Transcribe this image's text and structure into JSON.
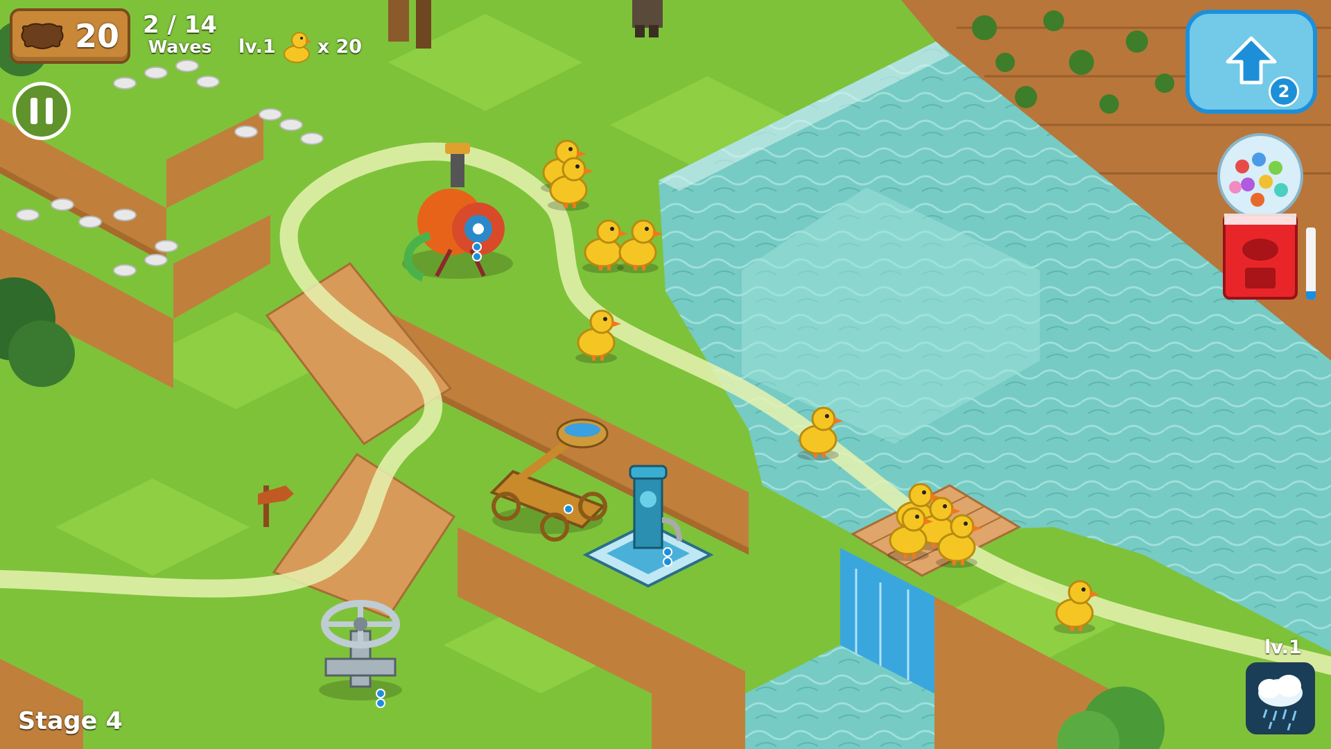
{
  "hud": {
    "currency": {
      "icon": "leather-hide-icon",
      "value": "20",
      "color": "#c98838"
    },
    "waves": {
      "count": "2 / 14",
      "label": "Waves"
    },
    "enemy_info": {
      "level": "lv.1",
      "icon": "yellow-duck-icon",
      "count": "x 20"
    },
    "pause": {
      "icon": "pause-icon"
    },
    "upgrade": {
      "icon": "up-arrow-icon",
      "badge": "2"
    },
    "gacha": {
      "icon": "gumball-machine-icon",
      "meter_fraction": 0.12
    },
    "weather": {
      "level": "lv.1",
      "icon": "rain-cloud-icon"
    },
    "stage": "Stage 4"
  },
  "colors": {
    "grass": "#7ec23a",
    "grass_light": "#9ad64a",
    "cliff": "#c0803c",
    "water": "#7fd0c8",
    "path": "#e6f2b0",
    "accent_blue": "#1d8fd9"
  },
  "map": {
    "towers": [
      {
        "name": "cannon-tower",
        "icon": "water-cannon-icon"
      },
      {
        "name": "catapult-tower",
        "icon": "catapult-icon"
      },
      {
        "name": "hydrant-tower",
        "icon": "hydrant-icon"
      },
      {
        "name": "valve-tower",
        "icon": "valve-icon"
      }
    ],
    "enemies": {
      "type": "duck",
      "visible_count": 11
    }
  }
}
